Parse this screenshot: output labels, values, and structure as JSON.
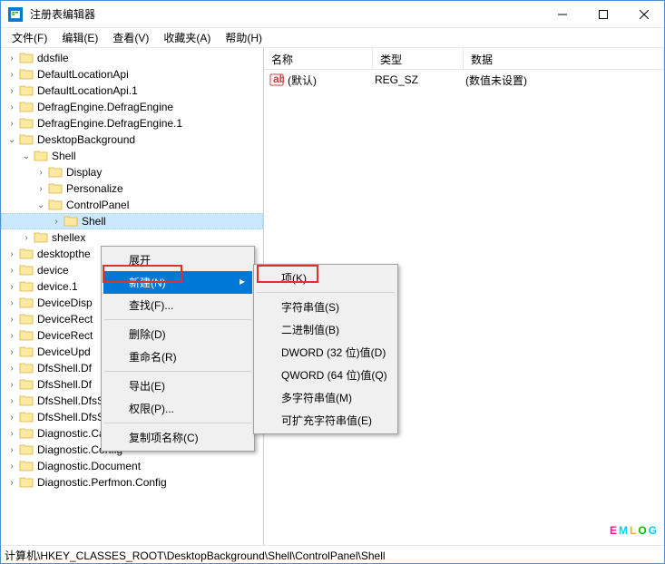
{
  "window": {
    "title": "注册表编辑器"
  },
  "menubar": {
    "file": "文件(F)",
    "edit": "编辑(E)",
    "view": "查看(V)",
    "favorites": "收藏夹(A)",
    "help": "帮助(H)"
  },
  "tree": [
    {
      "label": "ddsfile",
      "indent": 0,
      "expander": "closed"
    },
    {
      "label": "DefaultLocationApi",
      "indent": 0,
      "expander": "closed"
    },
    {
      "label": "DefaultLocationApi.1",
      "indent": 0,
      "expander": "closed"
    },
    {
      "label": "DefragEngine.DefragEngine",
      "indent": 0,
      "expander": "closed"
    },
    {
      "label": "DefragEngine.DefragEngine.1",
      "indent": 0,
      "expander": "closed"
    },
    {
      "label": "DesktopBackground",
      "indent": 0,
      "expander": "open"
    },
    {
      "label": "Shell",
      "indent": 1,
      "expander": "open"
    },
    {
      "label": "Display",
      "indent": 2,
      "expander": "closed"
    },
    {
      "label": "Personalize",
      "indent": 2,
      "expander": "closed"
    },
    {
      "label": "ControlPanel",
      "indent": 2,
      "expander": "open"
    },
    {
      "label": "Shell",
      "indent": 3,
      "expander": "closed",
      "selected": true
    },
    {
      "label": "shellex",
      "indent": 1,
      "expander": "closed"
    },
    {
      "label": "desktopthe",
      "indent": 0,
      "expander": "closed"
    },
    {
      "label": "device",
      "indent": 0,
      "expander": "closed"
    },
    {
      "label": "device.1",
      "indent": 0,
      "expander": "closed"
    },
    {
      "label": "DeviceDisp",
      "indent": 0,
      "expander": "closed"
    },
    {
      "label": "DeviceRect",
      "indent": 0,
      "expander": "closed"
    },
    {
      "label": "DeviceRect",
      "indent": 0,
      "expander": "closed"
    },
    {
      "label": "DeviceUpd",
      "indent": 0,
      "expander": "closed"
    },
    {
      "label": "DfsShell.Df",
      "indent": 0,
      "expander": "closed"
    },
    {
      "label": "DfsShell.Df",
      "indent": 0,
      "expander": "closed"
    },
    {
      "label": "DfsShell.DfsShellAdmin",
      "indent": 0,
      "expander": "closed"
    },
    {
      "label": "DfsShell.DfsShellAdmin.1",
      "indent": 0,
      "expander": "closed"
    },
    {
      "label": "Diagnostic.Cabinet",
      "indent": 0,
      "expander": "closed"
    },
    {
      "label": "Diagnostic.Config",
      "indent": 0,
      "expander": "closed"
    },
    {
      "label": "Diagnostic.Document",
      "indent": 0,
      "expander": "closed"
    },
    {
      "label": "Diagnostic.Perfmon.Config",
      "indent": 0,
      "expander": "closed"
    }
  ],
  "list": {
    "headers": {
      "name": "名称",
      "type": "类型",
      "data": "数据"
    },
    "rows": [
      {
        "name": "(默认)",
        "type": "REG_SZ",
        "data": "(数值未设置)"
      }
    ]
  },
  "context_menu_1": {
    "expand": "展开",
    "new": "新建(N)",
    "find": "查找(F)...",
    "delete": "删除(D)",
    "rename": "重命名(R)",
    "export": "导出(E)",
    "permissions": "权限(P)...",
    "copy_key_name": "复制项名称(C)"
  },
  "context_menu_2": {
    "key": "项(K)",
    "string": "字符串值(S)",
    "binary": "二进制值(B)",
    "dword": "DWORD (32 位)值(D)",
    "qword": "QWORD (64 位)值(Q)",
    "multi_string": "多字符串值(M)",
    "expandable": "可扩充字符串值(E)"
  },
  "statusbar": {
    "path": "计算机\\HKEY_CLASSES_ROOT\\DesktopBackground\\Shell\\ControlPanel\\Shell"
  },
  "watermark": "EMLOG"
}
